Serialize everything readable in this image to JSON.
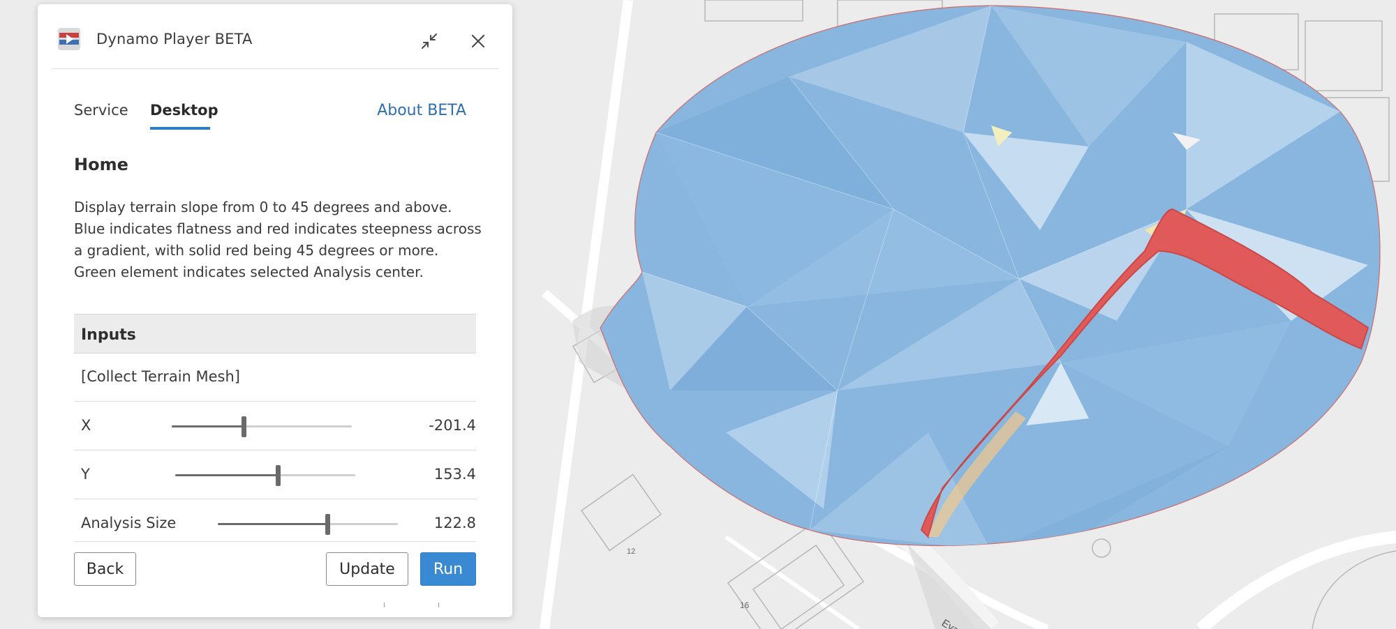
{
  "window": {
    "title": "Dynamo Player BETA",
    "icons": {
      "app": "dynamo-app-icon",
      "collapse": "collapse-icon",
      "close": "close-icon"
    }
  },
  "tabs": [
    {
      "label": "Service",
      "active": false
    },
    {
      "label": "Desktop",
      "active": true
    }
  ],
  "about_link": "About BETA",
  "section": {
    "title": "Home",
    "description": "Display terrain slope from 0 to 45 degrees and above. Blue indicates flatness and red indicates steepness across a gradient, with solid red being 45 degrees or more. Green element indicates selected Analysis center."
  },
  "inputs": {
    "header": "Inputs",
    "collect_label": "[Collect Terrain Mesh]",
    "sliders": [
      {
        "label": "X",
        "value": "-201.4",
        "fraction": 0.4
      },
      {
        "label": "Y",
        "value": "153.4",
        "fraction": 0.57
      },
      {
        "label": "Analysis Size",
        "value": "122.8",
        "fraction": 0.61
      }
    ]
  },
  "buttons": {
    "back": "Back",
    "update": "Update",
    "run": "Run"
  },
  "map_labels": [
    "Eva",
    "16",
    "12"
  ],
  "colors": {
    "accent": "#3a8ad3",
    "link": "#2f6fad",
    "flat_blue": "#88b6de",
    "steep_red": "#e05a5a",
    "map_bg": "#e9e9e9"
  }
}
